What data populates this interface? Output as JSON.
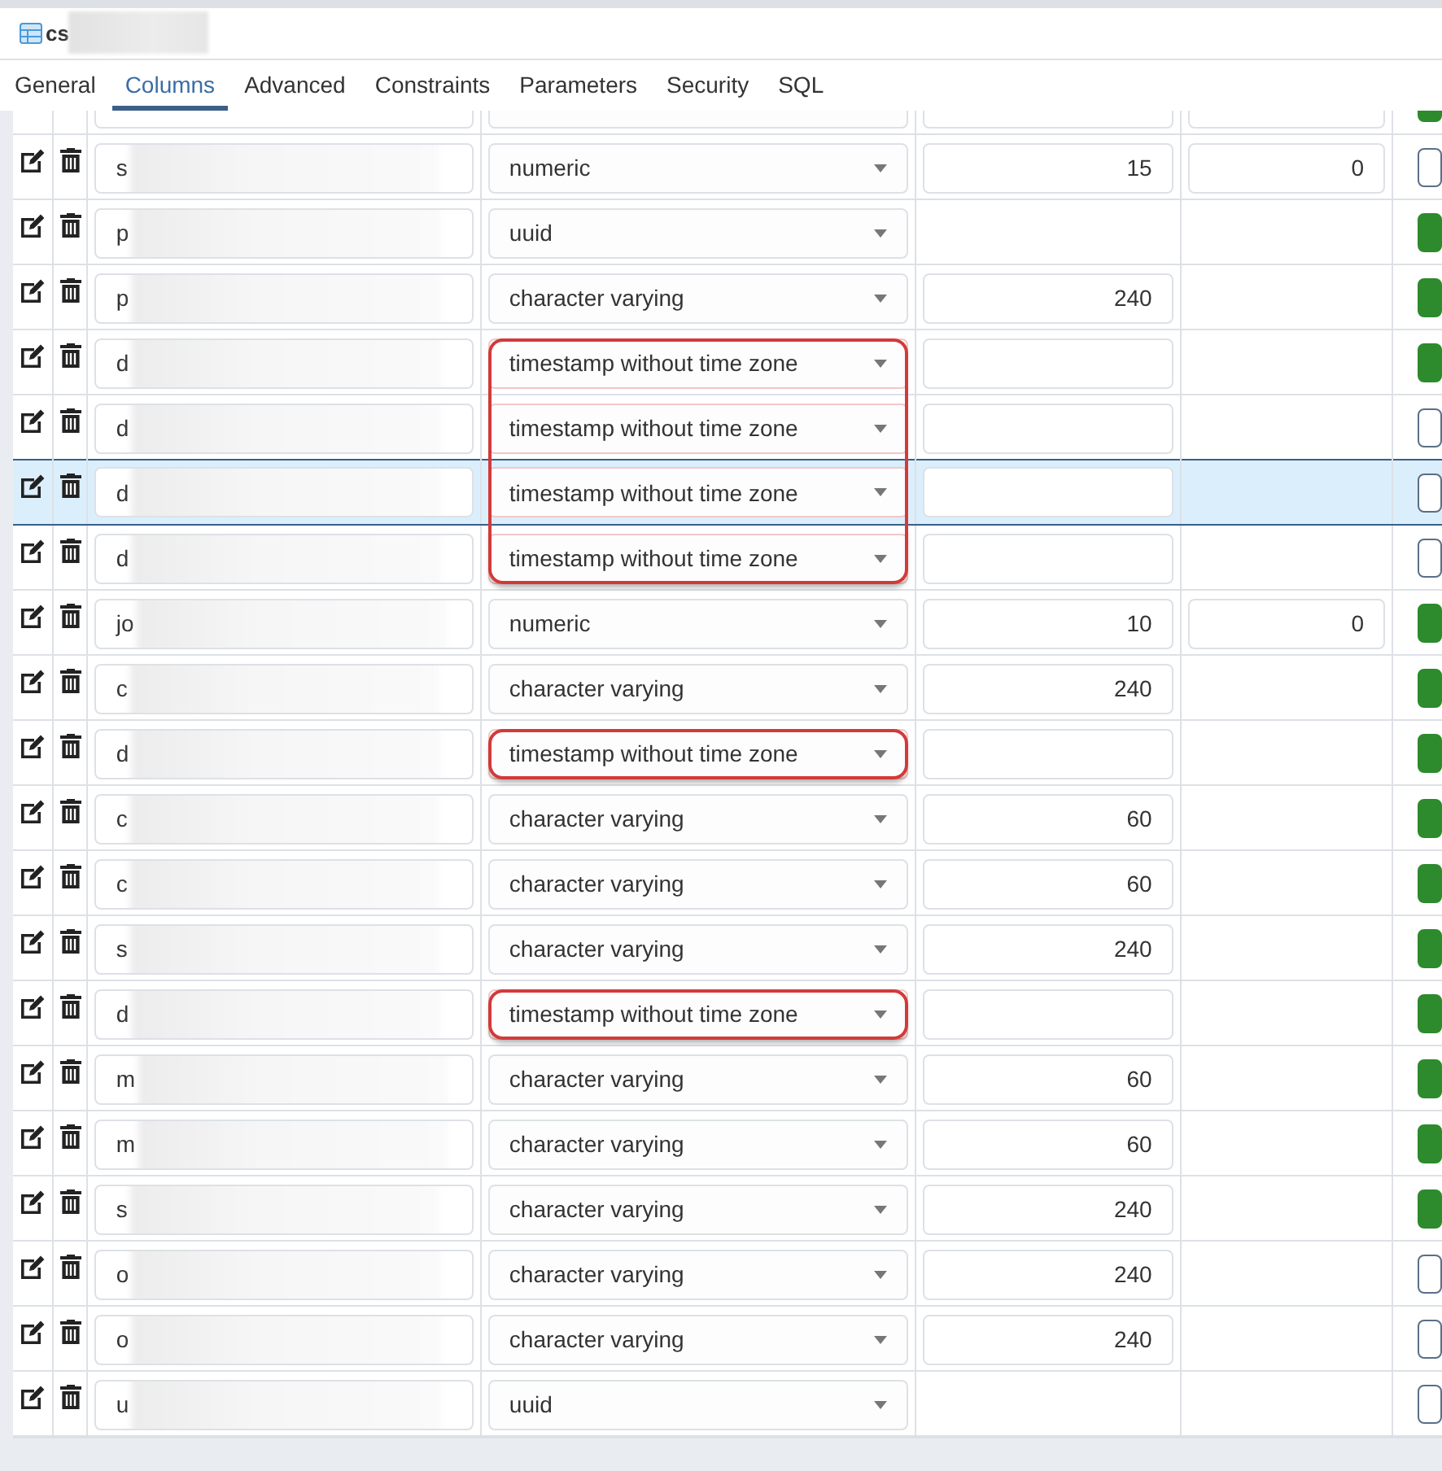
{
  "window": {
    "title": "cs",
    "title_redacted": true
  },
  "tabs": [
    {
      "label": "General",
      "selected": false
    },
    {
      "label": "Columns",
      "selected": true
    },
    {
      "label": "Advanced",
      "selected": false
    },
    {
      "label": "Constraints",
      "selected": false
    },
    {
      "label": "Parameters",
      "selected": false
    },
    {
      "label": "Security",
      "selected": false
    },
    {
      "label": "SQL",
      "selected": false
    }
  ],
  "names_redacted": true,
  "rows": [
    {
      "kind": "cut",
      "name": "",
      "type": "",
      "length": "",
      "precision": "",
      "not_null": true,
      "selected": false,
      "highlighted": false
    },
    {
      "kind": "full",
      "name": "s",
      "type": "numeric",
      "length": "15",
      "precision": "0",
      "not_null": false,
      "selected": false,
      "highlighted": false
    },
    {
      "kind": "full",
      "name": "p",
      "type": "uuid",
      "not_null": true,
      "selected": false,
      "highlighted": false
    },
    {
      "kind": "full",
      "name": "p",
      "type": "character varying",
      "length": "240",
      "not_null": true,
      "selected": false,
      "highlighted": false
    },
    {
      "kind": "full",
      "name": "d",
      "type": "timestamp without time zone",
      "length": "",
      "not_null": true,
      "selected": false,
      "highlighted": true
    },
    {
      "kind": "full",
      "name": "d",
      "type": "timestamp without time zone",
      "length": "",
      "not_null": false,
      "selected": false,
      "highlighted": true
    },
    {
      "kind": "full",
      "name": "d",
      "type": "timestamp without time zone",
      "length": "",
      "not_null": false,
      "selected": true,
      "highlighted": true
    },
    {
      "kind": "full",
      "name": "d",
      "type": "timestamp without time zone",
      "length": "",
      "not_null": false,
      "selected": false,
      "highlighted": true
    },
    {
      "kind": "full",
      "name": "jo",
      "type": "numeric",
      "length": "10",
      "precision": "0",
      "not_null": true,
      "selected": false,
      "highlighted": false
    },
    {
      "kind": "full",
      "name": "c",
      "type": "character varying",
      "length": "240",
      "not_null": true,
      "selected": false,
      "highlighted": false
    },
    {
      "kind": "full",
      "name": "d",
      "type": "timestamp without time zone",
      "length": "",
      "not_null": true,
      "selected": false,
      "highlighted": true
    },
    {
      "kind": "full",
      "name": "c",
      "type": "character varying",
      "length": "60",
      "not_null": true,
      "selected": false,
      "highlighted": false
    },
    {
      "kind": "full",
      "name": "c",
      "type": "character varying",
      "length": "60",
      "not_null": true,
      "selected": false,
      "highlighted": false
    },
    {
      "kind": "full",
      "name": "s",
      "type": "character varying",
      "length": "240",
      "not_null": true,
      "selected": false,
      "highlighted": false
    },
    {
      "kind": "full",
      "name": "d",
      "type": "timestamp without time zone",
      "length": "",
      "not_null": true,
      "selected": false,
      "highlighted": true
    },
    {
      "kind": "full",
      "name": "m",
      "type": "character varying",
      "length": "60",
      "not_null": true,
      "selected": false,
      "highlighted": false
    },
    {
      "kind": "full",
      "name": "m",
      "type": "character varying",
      "length": "60",
      "not_null": true,
      "selected": false,
      "highlighted": false
    },
    {
      "kind": "full",
      "name": "s",
      "type": "character varying",
      "length": "240",
      "not_null": true,
      "selected": false,
      "highlighted": false
    },
    {
      "kind": "full",
      "name": "o",
      "type": "character varying",
      "length": "240",
      "not_null": false,
      "selected": false,
      "highlighted": false
    },
    {
      "kind": "full",
      "name": "o",
      "type": "character varying",
      "length": "240",
      "not_null": false,
      "selected": false,
      "highlighted": false
    },
    {
      "kind": "full",
      "name": "u",
      "type": "uuid",
      "not_null": false,
      "selected": false,
      "highlighted": false
    }
  ]
}
